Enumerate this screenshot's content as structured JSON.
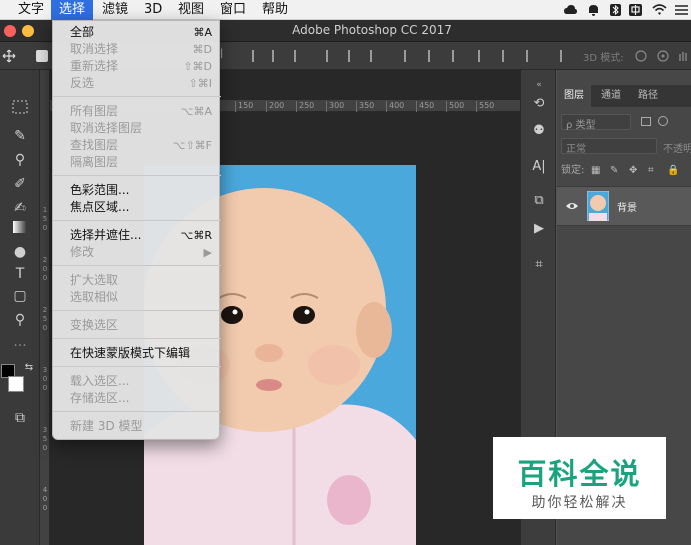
{
  "menubar": {
    "items": [
      "文字",
      "选择",
      "滤镜",
      "3D",
      "视图",
      "窗口",
      "帮助"
    ],
    "active_index": 1,
    "status_icons": [
      "creative-cloud-icon",
      "notification-icon",
      "bluetooth-icon",
      "input-method-icon",
      "wifi-icon",
      "control-center-icon"
    ]
  },
  "window": {
    "title": "Adobe Photoshop CC 2017"
  },
  "options_bar": {
    "mode_label": "3D 模式:"
  },
  "ruler": {
    "h_ticks": [
      "150",
      "200",
      "250",
      "300",
      "350",
      "400",
      "450",
      "500",
      "550"
    ],
    "v_ticks": [
      "1",
      "5",
      "0",
      "2",
      "0",
      "0",
      "2",
      "5",
      "0",
      "3",
      "0",
      "0",
      "3",
      "5",
      "0",
      "4",
      "0",
      "0"
    ]
  },
  "select_menu": {
    "items": [
      {
        "label": "全部",
        "shortcut": "⌘A",
        "enabled": true
      },
      {
        "label": "取消选择",
        "shortcut": "⌘D",
        "enabled": false
      },
      {
        "label": "重新选择",
        "shortcut": "⇧⌘D",
        "enabled": false
      },
      {
        "label": "反选",
        "shortcut": "⇧⌘I",
        "enabled": false
      },
      {
        "label": "所有图层",
        "shortcut": "⌥⌘A",
        "enabled": false
      },
      {
        "label": "取消选择图层",
        "shortcut": "",
        "enabled": false
      },
      {
        "label": "查找图层",
        "shortcut": "⌥⇧⌘F",
        "enabled": false
      },
      {
        "label": "隔离图层",
        "shortcut": "",
        "enabled": false
      },
      {
        "label": "色彩范围...",
        "shortcut": "",
        "enabled": true
      },
      {
        "label": "焦点区域...",
        "shortcut": "",
        "enabled": true
      },
      {
        "label": "选择并遮住...",
        "shortcut": "⌥⌘R",
        "enabled": true
      },
      {
        "label": "修改",
        "shortcut": "▶",
        "enabled": false
      },
      {
        "label": "扩大选取",
        "shortcut": "",
        "enabled": false
      },
      {
        "label": "选取相似",
        "shortcut": "",
        "enabled": false
      },
      {
        "label": "变换选区",
        "shortcut": "",
        "enabled": false
      },
      {
        "label": "在快速蒙版模式下编辑",
        "shortcut": "",
        "enabled": true
      },
      {
        "label": "载入选区...",
        "shortcut": "",
        "enabled": false
      },
      {
        "label": "存储选区...",
        "shortcut": "",
        "enabled": false
      },
      {
        "label": "新建 3D 模型",
        "shortcut": "",
        "enabled": false
      }
    ]
  },
  "layers_panel": {
    "tabs": [
      "图层",
      "通道",
      "路径"
    ],
    "active_tab": 0,
    "filter_label": "ρ 类型",
    "blend_mode": "正常",
    "opacity_label": "不透明",
    "lock_label": "锁定:",
    "layer_name": "背景"
  },
  "watermark": {
    "title": "百科全说",
    "subtitle": "助你轻松解决"
  },
  "colors": {
    "menu_highlight": "#2f6fe0",
    "photo_background": "#4aa8dc",
    "watermark_green": "#1aa37f"
  }
}
